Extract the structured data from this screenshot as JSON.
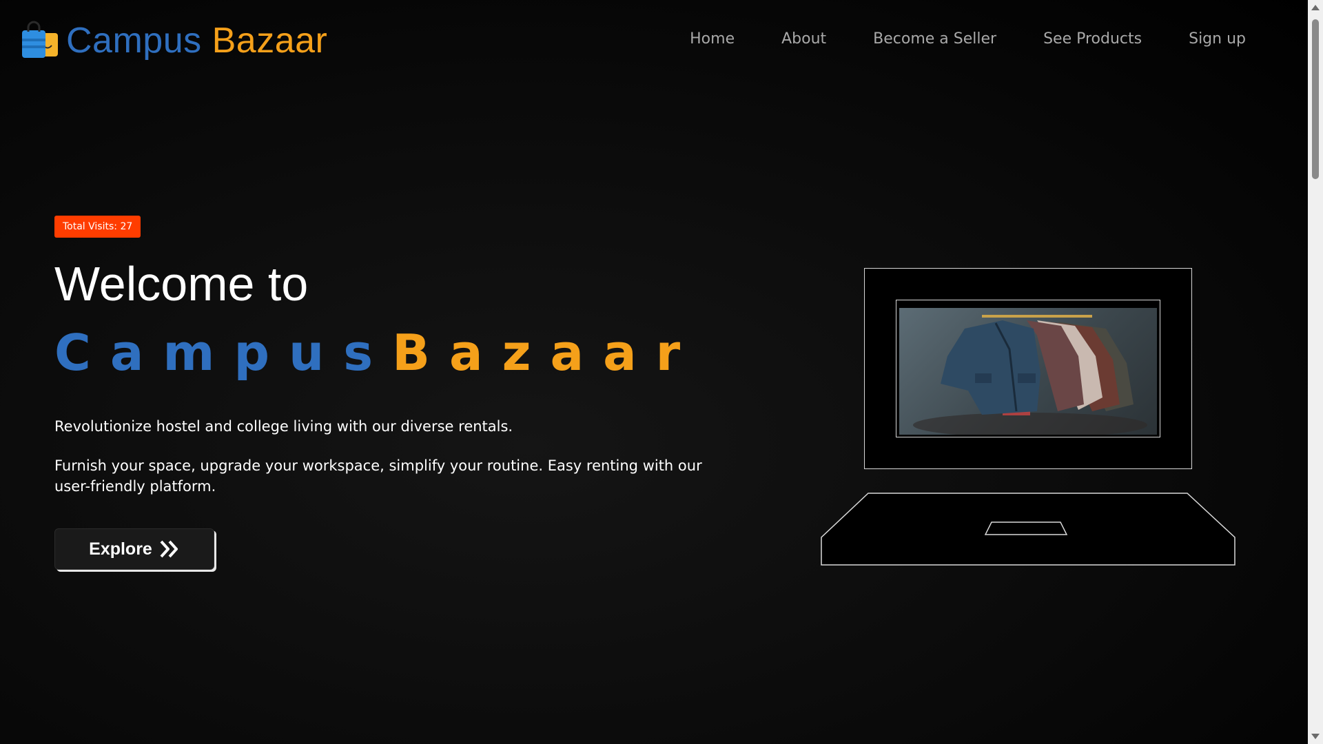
{
  "brand": {
    "part1": "Campus",
    "part2": "Bazaar",
    "icon": "shopping-bag-icon"
  },
  "nav": {
    "items": [
      "Home",
      "About",
      "Become a Seller",
      "See Products",
      "Sign up"
    ]
  },
  "hero": {
    "visits": "Total Visits: 27",
    "welcome": "Welcome to",
    "title_part1": "Campus",
    "title_part2": "Bazaar",
    "paragraph1": "Revolutionize hostel and college living with our diverse rentals.",
    "paragraph2": "Furnish your space, upgrade your workspace, simplify your routine. Easy renting with our user-friendly platform.",
    "cta_label": "Explore",
    "cta_icon": "double-chevron-right-icon"
  },
  "illustration": {
    "device": "laptop-icon",
    "screen_content": "jackets-on-rack-image"
  },
  "colors": {
    "brand_blue": "#2f6fbf",
    "brand_orange": "#f5a01a",
    "badge": "#ff3d00",
    "nav_text": "#a9a9a9"
  }
}
